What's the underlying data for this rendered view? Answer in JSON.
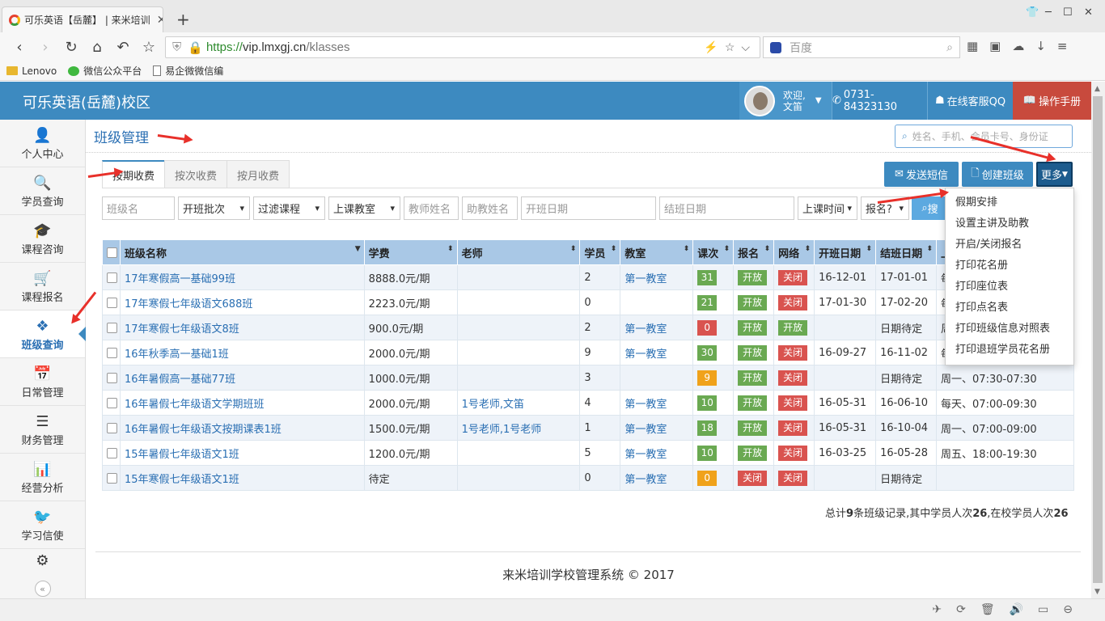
{
  "browser": {
    "tab_title": "可乐英语【岳麓】 | 来米培训",
    "url_protocol": "https://",
    "url_host": "vip.lmxgj.cn",
    "url_path": "/klasses",
    "search_placeholder": "百度",
    "bookmarks": [
      "Lenovo",
      "微信公众平台",
      "易企微微信编"
    ]
  },
  "header": {
    "brand": "可乐英语(岳麓)校区",
    "welcome": "欢迎,",
    "user_name": "文笛",
    "phone": "0731-84323130",
    "qq": "在线客服QQ",
    "manual": "操作手册"
  },
  "sidebar": {
    "items": [
      {
        "label": "个人中心",
        "icon": "user-icon"
      },
      {
        "label": "学员查询",
        "icon": "search-icon"
      },
      {
        "label": "课程咨询",
        "icon": "graduation-cap-icon"
      },
      {
        "label": "课程报名",
        "icon": "cart-icon"
      },
      {
        "label": "班级查询",
        "icon": "cubes-icon"
      },
      {
        "label": "日常管理",
        "icon": "calendar-icon"
      },
      {
        "label": "财务管理",
        "icon": "list-icon"
      },
      {
        "label": "经营分析",
        "icon": "bar-chart-icon"
      },
      {
        "label": "学习信使",
        "icon": "twitter-bird-icon"
      }
    ],
    "active_index": 4
  },
  "page": {
    "title": "班级管理",
    "search_placeholder": "姓名、手机、会员卡号、身份证",
    "tabs": [
      "按期收费",
      "按次收费",
      "按月收费"
    ],
    "active_tab": 0,
    "buttons": {
      "sms": "发送短信",
      "create": "创建班级",
      "more": "更多"
    },
    "filters": {
      "class_name": "班级名",
      "batch": "开班批次",
      "course": "过滤课程",
      "room": "上课教室",
      "teacher": "教师姓名",
      "assistant": "助教姓名",
      "start_date": "开班日期",
      "end_date": "结班日期",
      "time": "上课时间",
      "enroll": "报名?",
      "go": "搜"
    },
    "more_menu": [
      "假期安排",
      "设置主讲及助教",
      "开启/关闭报名",
      "打印花名册",
      "打印座位表",
      "打印点名表",
      "打印班级信息对照表",
      "打印退班学员花名册"
    ]
  },
  "table": {
    "columns": [
      "班级名称",
      "学费",
      "老师",
      "学员",
      "教室",
      "课次",
      "报名",
      "网络",
      "开班日期",
      "结班日期",
      "上"
    ],
    "rows": [
      {
        "name": "17年寒假高一基础99班",
        "fee": "8888.0元/期",
        "teacher": "",
        "students": "2",
        "room": "第一教室",
        "lessons": "31",
        "lesson_color": "#6aa952",
        "enroll": "开放",
        "enroll_color": "#6aa952",
        "online": "关闭",
        "online_color": "#d9534f",
        "start": "16-12-01",
        "end": "17-01-01",
        "time": "每"
      },
      {
        "name": "17年寒假七年级语文688班",
        "fee": "2223.0元/期",
        "teacher": "",
        "students": "0",
        "room": "",
        "lessons": "21",
        "lesson_color": "#6aa952",
        "enroll": "开放",
        "enroll_color": "#6aa952",
        "online": "关闭",
        "online_color": "#d9534f",
        "start": "17-01-30",
        "end": "17-02-20",
        "time": "每"
      },
      {
        "name": "17年寒假七年级语文8班",
        "fee": "900.0元/期",
        "teacher": "",
        "students": "2",
        "room": "第一教室",
        "lessons": "0",
        "lesson_color": "#d9534f",
        "enroll": "开放",
        "enroll_color": "#6aa952",
        "online": "开放",
        "online_color": "#6aa952",
        "start": "",
        "end": "日期待定",
        "time": "周"
      },
      {
        "name": "16年秋季高一基础1班",
        "fee": "2000.0元/期",
        "teacher": "",
        "students": "9",
        "room": "第一教室",
        "lessons": "30",
        "lesson_color": "#6aa952",
        "enroll": "开放",
        "enroll_color": "#6aa952",
        "online": "关闭",
        "online_color": "#d9534f",
        "start": "16-09-27",
        "end": "16-11-02",
        "time": "每"
      },
      {
        "name": "16年暑假高一基础77班",
        "fee": "1000.0元/期",
        "teacher": "",
        "students": "3",
        "room": "",
        "lessons": "9",
        "lesson_color": "#f0a21b",
        "enroll": "开放",
        "enroll_color": "#6aa952",
        "online": "关闭",
        "online_color": "#d9534f",
        "start": "",
        "end": "日期待定",
        "time": "周一、07:30-07:30"
      },
      {
        "name": "16年暑假七年级语文学期班班",
        "fee": "2000.0元/期",
        "teacher": "1号老师,文笛",
        "students": "4",
        "room": "第一教室",
        "lessons": "10",
        "lesson_color": "#6aa952",
        "enroll": "开放",
        "enroll_color": "#6aa952",
        "online": "关闭",
        "online_color": "#d9534f",
        "start": "16-05-31",
        "end": "16-06-10",
        "time": "每天、07:00-09:30"
      },
      {
        "name": "16年暑假七年级语文按期课表1班",
        "fee": "1500.0元/期",
        "teacher": "1号老师,1号老师",
        "students": "1",
        "room": "第一教室",
        "lessons": "18",
        "lesson_color": "#6aa952",
        "enroll": "开放",
        "enroll_color": "#6aa952",
        "online": "关闭",
        "online_color": "#d9534f",
        "start": "16-05-31",
        "end": "16-10-04",
        "time": "周一、07:00-09:00"
      },
      {
        "name": "15年暑假七年级语文1班",
        "fee": "1200.0元/期",
        "teacher": "",
        "students": "5",
        "room": "第一教室",
        "lessons": "10",
        "lesson_color": "#6aa952",
        "enroll": "开放",
        "enroll_color": "#6aa952",
        "online": "关闭",
        "online_color": "#d9534f",
        "start": "16-03-25",
        "end": "16-05-28",
        "time": "周五、18:00-19:30"
      },
      {
        "name": "15年寒假七年级语文1班",
        "fee": "待定",
        "teacher": "",
        "students": "0",
        "room": "第一教室",
        "lessons": "0",
        "lesson_color": "#f0a21b",
        "enroll": "关闭",
        "enroll_color": "#d9534f",
        "online": "关闭",
        "online_color": "#d9534f",
        "start": "",
        "end": "日期待定",
        "time": ""
      }
    ]
  },
  "summary": {
    "prefix": "总计",
    "count": "9",
    "mid": "条班级记录,其中学员人次",
    "total": "26",
    "mid2": ",在校学员人次",
    "active": "26"
  },
  "footer": "来米培训学校管理系统 © 2017"
}
